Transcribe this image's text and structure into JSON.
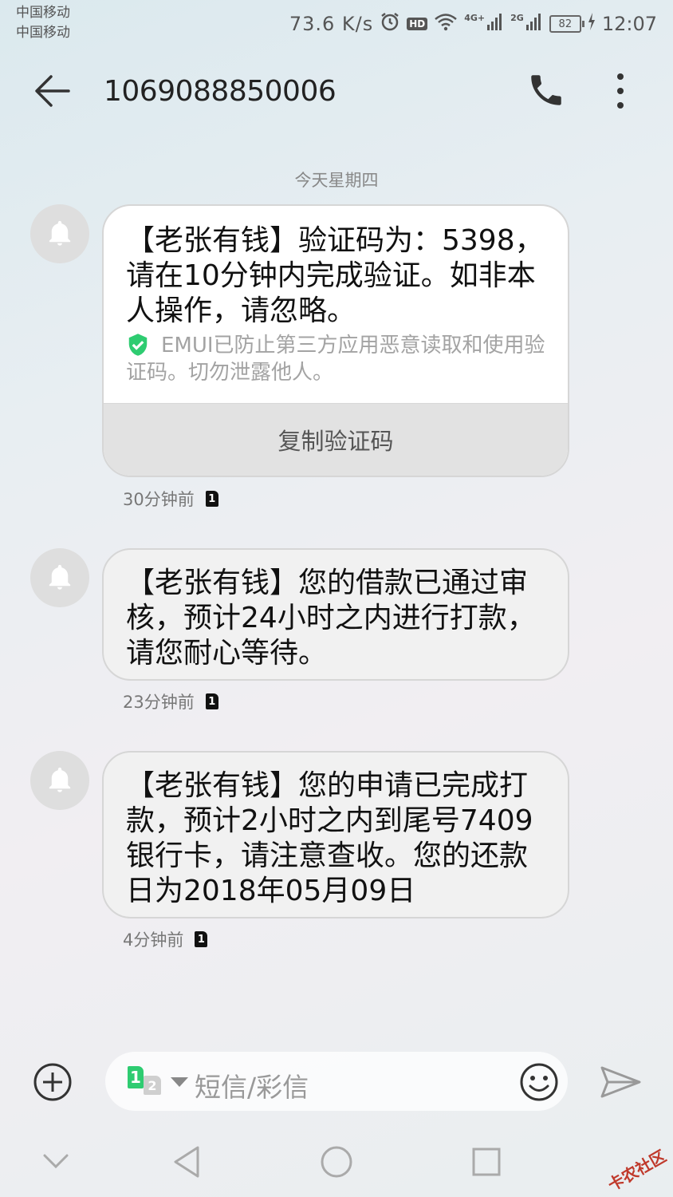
{
  "status_bar": {
    "carrier_1": "中国移动",
    "carrier_2": "中国移动",
    "net_speed": "73.6  K/s",
    "hd": "HD",
    "net_4g": "4G+",
    "net_2g": "2G",
    "battery": "82",
    "time": "12:07"
  },
  "header": {
    "contact_number": "1069088850006"
  },
  "date_separator": "今天星期四",
  "messages": [
    {
      "text": "【老张有钱】验证码为：5398，请在10分钟内完成验证。如非本人操作，请忽略。",
      "security_note": "EMUI已防止第三方应用恶意读取和使用验证码。切勿泄露他人。",
      "copy_button": "复制验证码",
      "time": "30分钟前",
      "sim": "1"
    },
    {
      "text": "【老张有钱】您的借款已通过审核，预计24小时之内进行打款，请您耐心等待。",
      "time": "23分钟前",
      "sim": "1"
    },
    {
      "text": "【老张有钱】您的申请已完成打款，预计2小时之内到尾号7409银行卡，请注意查收。您的还款日为2018年05月09日",
      "time": "4分钟前",
      "sim": "1"
    }
  ],
  "composer": {
    "sim_active": "1",
    "sim_other": "2",
    "placeholder": "短信/彩信"
  },
  "watermark": "卡农社区",
  "colors": {
    "shield": "#2ecc71",
    "sim_badge_active": "#2ecc71"
  }
}
